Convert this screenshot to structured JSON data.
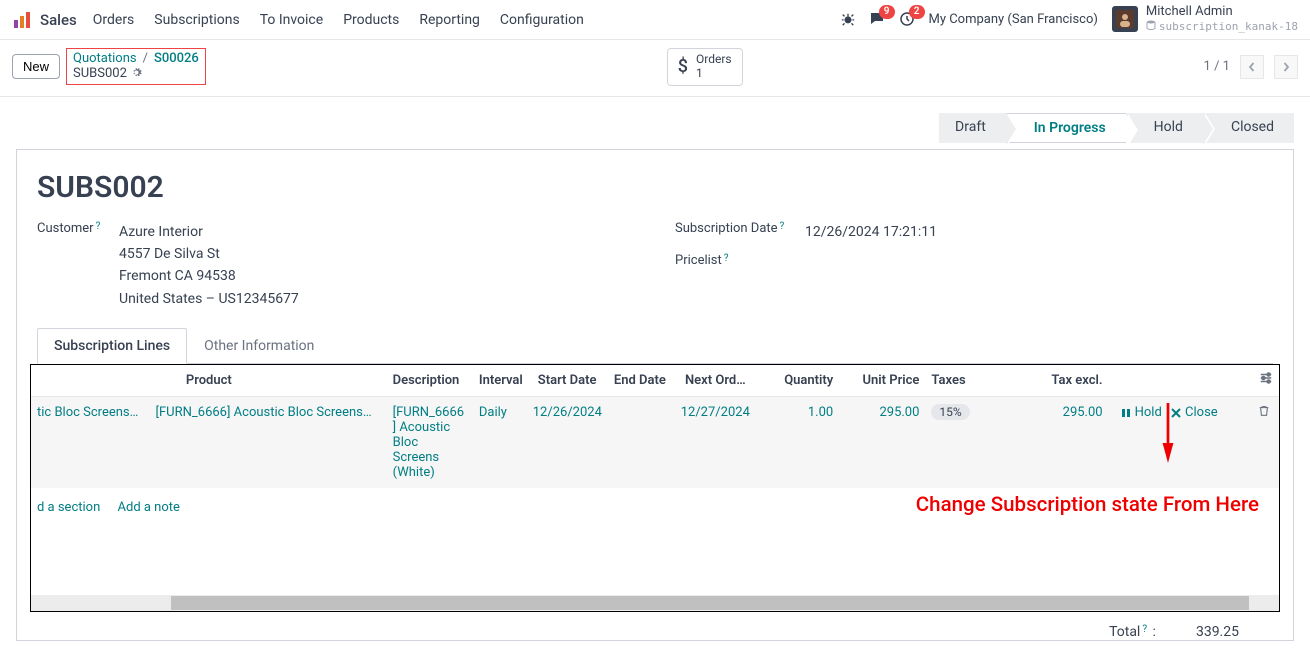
{
  "nav": {
    "brand": "Sales",
    "links": [
      "Orders",
      "Subscriptions",
      "To Invoice",
      "Products",
      "Reporting",
      "Configuration"
    ],
    "chat_badge": "9",
    "clock_badge": "2",
    "company": "My Company (San Francisco)",
    "user_name": "Mitchell Admin",
    "user_db": "subscription_kanak-18"
  },
  "controlbar": {
    "new_btn": "New",
    "breadcrumb_root": "Quotations",
    "breadcrumb_current": "S00026",
    "breadcrumb_sub": "SUBS002",
    "stat_label": "Orders",
    "stat_value": "1",
    "pager": "1 / 1"
  },
  "status": {
    "steps": [
      "Draft",
      "In Progress",
      "Hold",
      "Closed"
    ],
    "active": "In Progress"
  },
  "form": {
    "title": "SUBS002",
    "customer_label": "Customer",
    "customer_name": "Azure Interior",
    "customer_addr1": "4557 De Silva St",
    "customer_addr2": "Fremont CA 94538",
    "customer_addr3": "United States – US12345677",
    "subdate_label": "Subscription Date",
    "subdate_value": "12/26/2024 17:21:11",
    "pricelist_label": "Pricelist"
  },
  "tabs": {
    "t1": "Subscription Lines",
    "t2": "Other Information"
  },
  "table": {
    "headers": {
      "product": "Product",
      "description": "Description",
      "interval": "Interval",
      "start": "Start Date",
      "end": "End Date",
      "next": "Next Ord…",
      "qty": "Quantity",
      "unit": "Unit Price",
      "taxes": "Taxes",
      "taxexcl": "Tax excl."
    },
    "row": {
      "product_pre": "tic Bloc Screens…",
      "product": "[FURN_6666] Acoustic Bloc Screens…",
      "description": "[FURN_6666] Acoustic Bloc Screens (White)",
      "interval": "Daily",
      "start": "12/26/2024",
      "end": "",
      "next": "12/27/2024",
      "qty": "1.00",
      "unit": "295.00",
      "taxes": "15%",
      "taxexcl": "295.00",
      "hold": "Hold",
      "close": "Close"
    },
    "add_section": "d a section",
    "add_note": "Add a note"
  },
  "annotation": "Change Subscription state From Here",
  "totals": {
    "label": "Total",
    "value": "339.25"
  }
}
